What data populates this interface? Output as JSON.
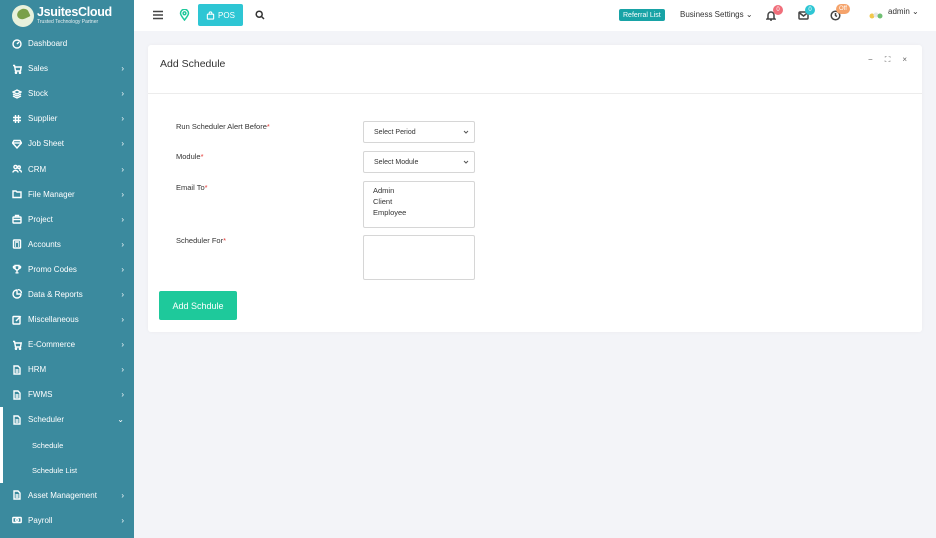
{
  "app": {
    "logo_name": "JsuitesCloud",
    "logo_tagline": "Trusted Technology Partner"
  },
  "sidebar": {
    "items": [
      {
        "label": "Dashboard",
        "icon": "dashboard-icon",
        "chevron": ""
      },
      {
        "label": "Sales",
        "icon": "cart-icon",
        "chevron": "›"
      },
      {
        "label": "Stock",
        "icon": "layers-icon",
        "chevron": "›"
      },
      {
        "label": "Supplier",
        "icon": "hash-icon",
        "chevron": "›"
      },
      {
        "label": "Job Sheet",
        "icon": "diamond-icon",
        "chevron": "›"
      },
      {
        "label": "CRM",
        "icon": "users-icon",
        "chevron": "›"
      },
      {
        "label": "File Manager",
        "icon": "folder-icon",
        "chevron": "›"
      },
      {
        "label": "Project",
        "icon": "briefcase-icon",
        "chevron": "›"
      },
      {
        "label": "Accounts",
        "icon": "calculator-icon",
        "chevron": "›"
      },
      {
        "label": "Promo Codes",
        "icon": "trophy-icon",
        "chevron": "›"
      },
      {
        "label": "Data & Reports",
        "icon": "pie-chart-icon",
        "chevron": "›"
      },
      {
        "label": "Miscellaneous",
        "icon": "edit-icon",
        "chevron": "›"
      },
      {
        "label": "E-Commerce",
        "icon": "cart-icon",
        "chevron": "›"
      },
      {
        "label": "HRM",
        "icon": "document-icon",
        "chevron": "›"
      },
      {
        "label": "FWMS",
        "icon": "document-icon",
        "chevron": "›"
      },
      {
        "label": "Scheduler",
        "icon": "document-icon",
        "chevron": "⌄"
      }
    ],
    "sub_items": [
      "Schedule",
      "Schedule List"
    ],
    "after_items": [
      {
        "label": "Asset Management",
        "icon": "document-icon",
        "chevron": "›"
      },
      {
        "label": "Payroll",
        "icon": "money-icon",
        "chevron": "›"
      }
    ]
  },
  "topbar": {
    "pos_label": "POS",
    "referral_label": "Referral List",
    "business_settings": "Business Settings",
    "notifications_count": "0",
    "messages_count": "0",
    "clock_badge": "Off",
    "user_name": "admin"
  },
  "card": {
    "title": "Add Schedule",
    "tools": [
      "−",
      "⛶",
      "×"
    ]
  },
  "form": {
    "alert_label": "Run Scheduler Alert Before",
    "alert_placeholder": "Select Period",
    "module_label": "Module",
    "module_placeholder": "Select Module",
    "email_label": "Email To",
    "email_options": [
      "Admin",
      "Client",
      "Employee"
    ],
    "scheduler_for_label": "Scheduler For",
    "required_mark": "*",
    "submit_label": "Add Schdule"
  },
  "colors": {
    "sidebar_bg": "#3b8a9e",
    "pos_button": "#2ec6d4",
    "referral_badge": "#18a3a6",
    "submit_button": "#1ec99b",
    "notification_badge": "#f06e7a",
    "message_badge": "#2ec6d4",
    "off_badge": "#f5a36b"
  }
}
